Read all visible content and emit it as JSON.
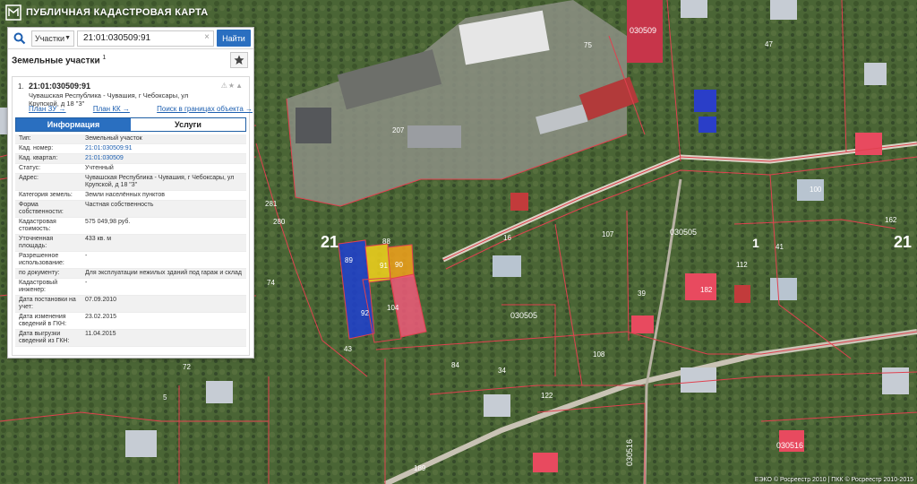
{
  "app": {
    "title": "ПУБЛИЧНАЯ КАДАСТРОВАЯ КАРТА"
  },
  "search": {
    "type_label": "Участки",
    "value": "21:01:030509:91",
    "clear_symbol": "×",
    "find_label": "Найти"
  },
  "section": {
    "title": "Земельные участки",
    "count": "1"
  },
  "result": {
    "index": "1.",
    "cad_number": "21:01:030509:91",
    "address": "Чувашская Республика - Чувашия, г Чебоксары, ул Крупской, д 18 \"3\"",
    "links": {
      "plan_zu": "План ЗУ →",
      "plan_kk": "План КК →",
      "search_bounds": "Поиск в границах объекта →"
    },
    "tabs": [
      {
        "label": "Информация",
        "active": true
      },
      {
        "label": "Услуги",
        "active": false
      }
    ],
    "info": [
      {
        "key": "Тип:",
        "value": "Земельный участок"
      },
      {
        "key": "Кад. номер:",
        "value": "21:01:030509:91",
        "link": true
      },
      {
        "key": "Кад. квартал:",
        "value": "21:01:030509",
        "link": true
      },
      {
        "key": "Статус:",
        "value": "Учтенный"
      },
      {
        "key": "Адрес:",
        "value": "Чувашская Республика - Чувашия, г Чебоксары, ул Крупской, д 18 \"3\""
      },
      {
        "key": "Категория земель:",
        "value": "Земли населённых пунктов"
      },
      {
        "key": "Форма собственности:",
        "value": "Частная собственность"
      },
      {
        "key": "Кадастровая стоимость:",
        "value": "575 049,98 руб."
      },
      {
        "key": "Уточненная площадь:",
        "value": "433 кв. м"
      },
      {
        "key": "Разрешенное использование:",
        "value": "-"
      },
      {
        "key": "по документу:",
        "value": "Для эксплуатации нежилых зданий под гараж и склад"
      },
      {
        "key": "Кадастровый инженер:",
        "value": "-"
      },
      {
        "key": "Дата постановки на учет:",
        "value": "07.09.2010"
      },
      {
        "key": "Дата изменения сведений в ГКН:",
        "value": "23.02.2015"
      },
      {
        "key": "Дата выгрузки сведений из ГКН:",
        "value": "11.04.2015"
      }
    ]
  },
  "map": {
    "district_labels": [
      "21",
      "21",
      "1"
    ],
    "quarter_labels": [
      "030509",
      "030505",
      "030505",
      "030516",
      "030516"
    ],
    "selected_parcel_labels": [
      "89",
      "91",
      "90",
      "92",
      "104",
      "88"
    ],
    "parcel_numbers": [
      "207",
      "281",
      "280",
      "74",
      "75",
      "47",
      "43",
      "72",
      "5",
      "100",
      "162",
      "182",
      "112",
      "41",
      "16",
      "84",
      "34",
      "107",
      "108",
      "39",
      "122",
      "189"
    ],
    "selection_colors": {
      "blue": "#1f3fd1",
      "yellow": "#f2d21b",
      "orange": "#f2a21b",
      "pink": "#f05a7a"
    },
    "boundary_color": "#e0414f"
  },
  "footer": {
    "text": "ЕЭКО © Росреестр 2010 | ПКК © Росреестр 2010-2015"
  }
}
